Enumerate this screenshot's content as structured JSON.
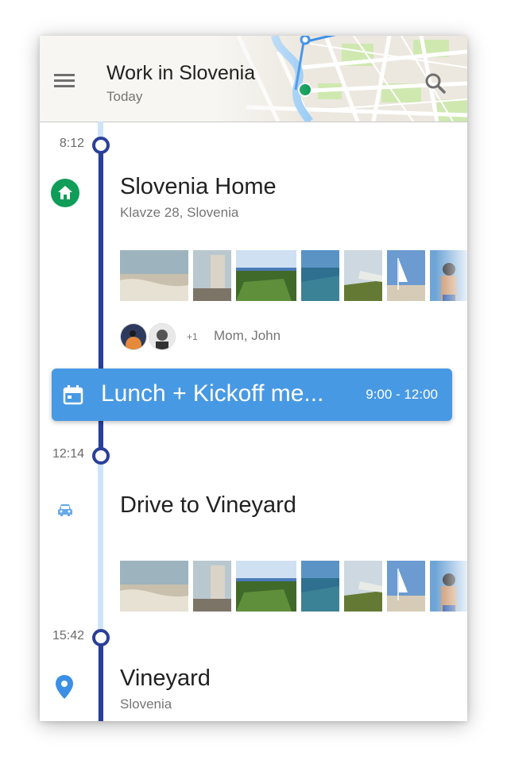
{
  "header": {
    "title": "Work in Slovenia",
    "subtitle": "Today",
    "menu_icon": "menu-icon",
    "search_icon": "search-icon"
  },
  "timeline": {
    "entries": [
      {
        "time": "8:12",
        "icon": "home-icon",
        "title": "Slovenia Home",
        "subtitle": "Klavze 28, Slovenia",
        "photo_count": 8,
        "people": {
          "extra_count": "+1",
          "names": "Mom, John"
        }
      },
      {
        "time": "12:14",
        "icon": "car-icon",
        "title": "Drive to Vineyard",
        "photo_count": 8
      },
      {
        "time": "15:42",
        "icon": "location-pin-icon",
        "title": "Vineyard",
        "subtitle": "Slovenia"
      }
    ],
    "event": {
      "icon": "calendar-icon",
      "title": "Lunch + Kickoff me...",
      "time": "9:00 - 12:00"
    }
  },
  "colors": {
    "rail_dark": "#2a3f9a",
    "rail_light": "#cde4f8",
    "event_card": "#4899e3",
    "home_icon": "#0f9d58",
    "car_icon": "#64a9e8",
    "pin_icon": "#3d8fe6"
  }
}
